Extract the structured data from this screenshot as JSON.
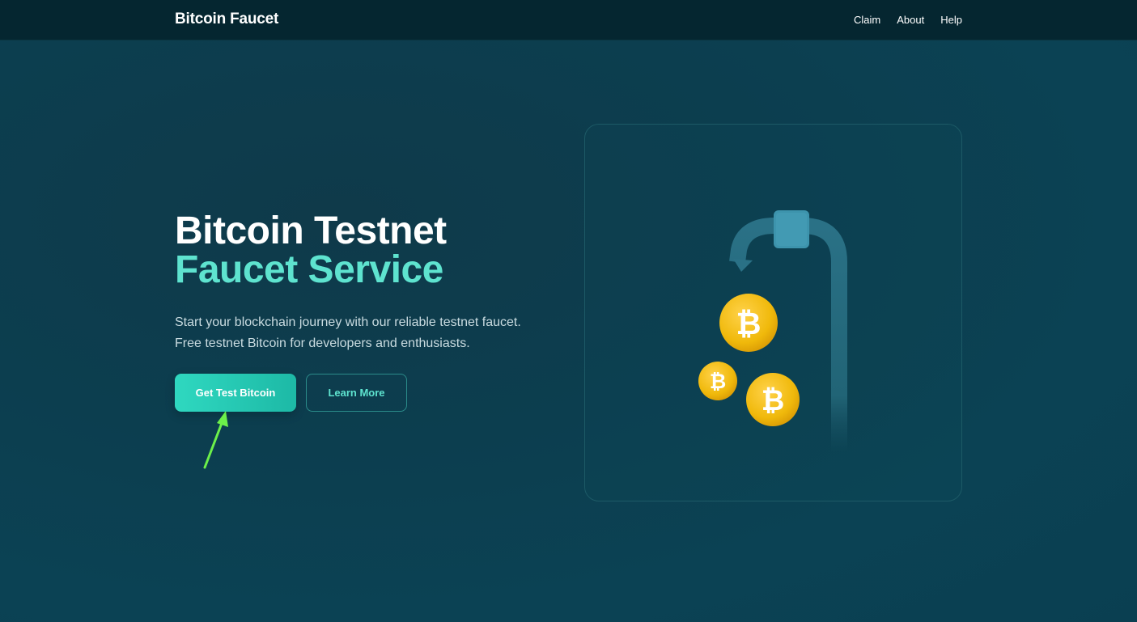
{
  "navbar": {
    "brand": "Bitcoin Faucet",
    "links": [
      "Claim",
      "About",
      "Help"
    ]
  },
  "hero": {
    "title_line1": "Bitcoin Testnet",
    "title_line2": "Faucet Service",
    "description_line1": "Start your blockchain journey with our reliable testnet faucet.",
    "description_line2": "Free testnet Bitcoin for developers and enthusiasts.",
    "primary_button": "Get Test Bitcoin",
    "secondary_button": "Learn More"
  },
  "illustration": {
    "coin_symbol": "₿",
    "icons": [
      "faucet-icon",
      "bitcoin-coin-icon"
    ]
  },
  "colors": {
    "accent": "#5ee3cf",
    "primary_button": "#2fd8c0",
    "coin": "#f0b90b",
    "annotation_arrow": "#6cf04a"
  }
}
